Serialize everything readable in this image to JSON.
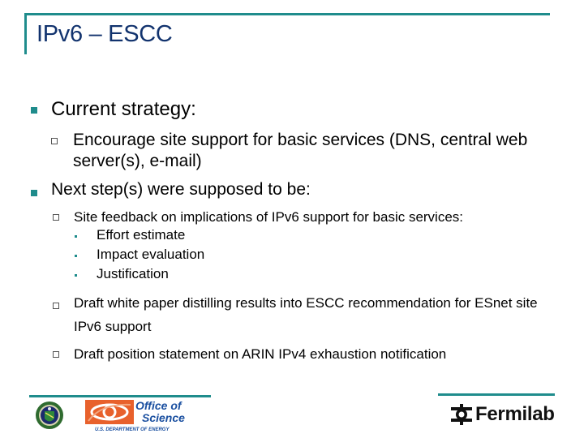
{
  "slide": {
    "title": "IPv6 – ESCC",
    "bullets": [
      {
        "text": "Current strategy:",
        "children": [
          {
            "text": "Encourage site support for basic services (DNS, central web server(s), e-mail)"
          }
        ]
      },
      {
        "text": "Next step(s) were supposed to be:",
        "children": [
          {
            "text": "Site feedback on implications of IPv6 support for basic services:",
            "children": [
              "Effort estimate",
              "Impact evaluation",
              "Justification"
            ]
          },
          {
            "text": "Draft white paper distilling results into ESCC recommendation for ESnet site IPv6 support"
          },
          {
            "text": "Draft position statement on ARIN IPv4 exhaustion notification"
          }
        ]
      }
    ]
  },
  "footer": {
    "office_of_science_line1": "Office of",
    "office_of_science_line2": "Science",
    "office_of_science_sub": "U.S. DEPARTMENT OF ENERGY",
    "fermilab": "Fermilab"
  },
  "colors": {
    "accent": "#1f8c8c",
    "title": "#12336e",
    "os_blue": "#1a4fa0",
    "os_orange": "#e8612c"
  }
}
